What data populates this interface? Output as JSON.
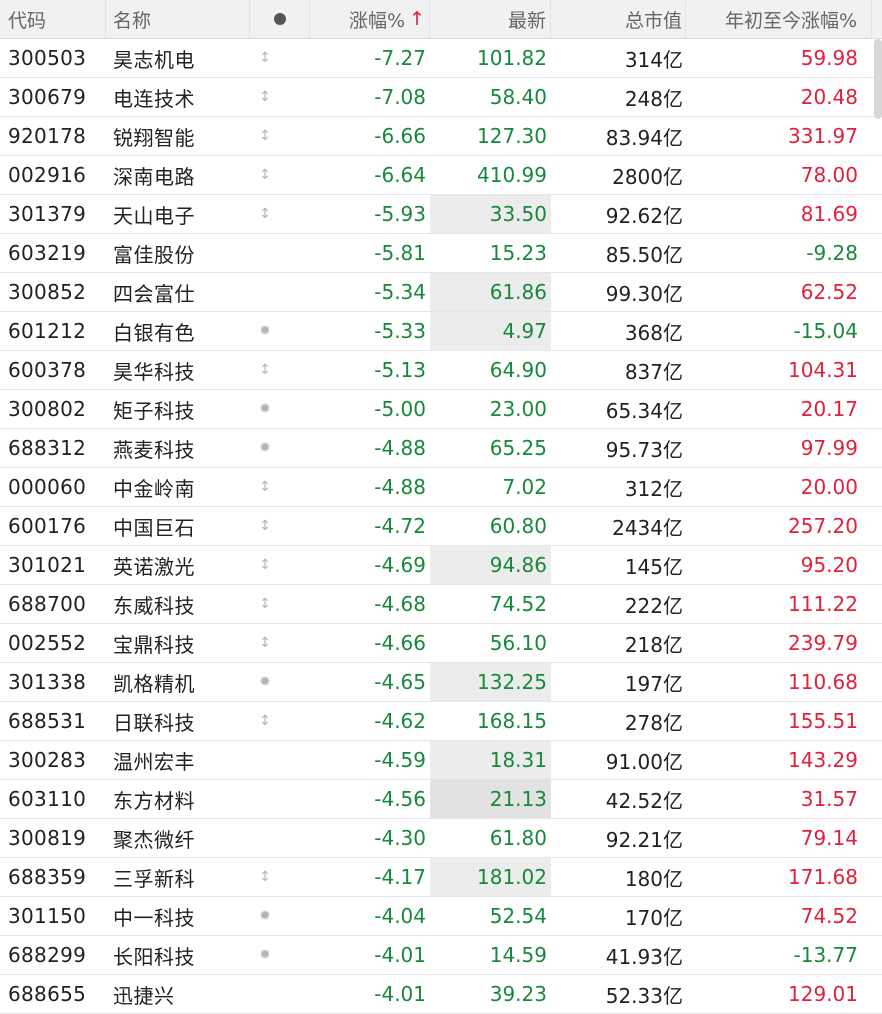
{
  "header": {
    "code": "代码",
    "name": "名称",
    "flag": "●",
    "change": "涨幅%",
    "sort_icon": "↑",
    "last": "最新",
    "mktcap": "总市值",
    "ytd": "年初至今涨幅%"
  },
  "colors": {
    "up": "#e0213b",
    "down": "#18883a",
    "header_bg": "#f1f1f1",
    "highlight_bg": "#ececec"
  },
  "rows": [
    {
      "code": "300503",
      "name": "昊志机电",
      "flag": "↕",
      "change": "-7.27",
      "last": "101.82",
      "mktcap": "314亿",
      "ytd": "59.98"
    },
    {
      "code": "300679",
      "name": "电连技术",
      "flag": "↕",
      "change": "-7.08",
      "last": "58.40",
      "mktcap": "248亿",
      "ytd": "20.48"
    },
    {
      "code": "920178",
      "name": "锐翔智能",
      "flag": "↕",
      "change": "-6.66",
      "last": "127.30",
      "mktcap": "83.94亿",
      "ytd": "331.97"
    },
    {
      "code": "002916",
      "name": "深南电路",
      "flag": "↕",
      "change": "-6.64",
      "last": "410.99",
      "mktcap": "2800亿",
      "ytd": "78.00"
    },
    {
      "code": "301379",
      "name": "天山电子",
      "flag": "↕",
      "change": "-5.93",
      "last": "33.50",
      "mktcap": "92.62亿",
      "ytd": "81.69"
    },
    {
      "code": "603219",
      "name": "富佳股份",
      "flag": "",
      "change": "-5.81",
      "last": "15.23",
      "mktcap": "85.50亿",
      "ytd": "-9.28"
    },
    {
      "code": "300852",
      "name": "四会富仕",
      "flag": "",
      "change": "-5.34",
      "last": "61.86",
      "mktcap": "99.30亿",
      "ytd": "62.52"
    },
    {
      "code": "601212",
      "name": "白银有色",
      "flag": "✹",
      "change": "-5.33",
      "last": "4.97",
      "mktcap": "368亿",
      "ytd": "-15.04"
    },
    {
      "code": "600378",
      "name": "昊华科技",
      "flag": "↕",
      "change": "-5.13",
      "last": "64.90",
      "mktcap": "837亿",
      "ytd": "104.31"
    },
    {
      "code": "300802",
      "name": "矩子科技",
      "flag": "✹",
      "change": "-5.00",
      "last": "23.00",
      "mktcap": "65.34亿",
      "ytd": "20.17"
    },
    {
      "code": "688312",
      "name": "燕麦科技",
      "flag": "✹",
      "change": "-4.88",
      "last": "65.25",
      "mktcap": "95.73亿",
      "ytd": "97.99"
    },
    {
      "code": "000060",
      "name": "中金岭南",
      "flag": "↕",
      "change": "-4.88",
      "last": "7.02",
      "mktcap": "312亿",
      "ytd": "20.00"
    },
    {
      "code": "600176",
      "name": "中国巨石",
      "flag": "↕",
      "change": "-4.72",
      "last": "60.80",
      "mktcap": "2434亿",
      "ytd": "257.20"
    },
    {
      "code": "301021",
      "name": "英诺激光",
      "flag": "↕",
      "change": "-4.69",
      "last": "94.86",
      "mktcap": "145亿",
      "ytd": "95.20"
    },
    {
      "code": "688700",
      "name": "东威科技",
      "flag": "↕",
      "change": "-4.68",
      "last": "74.52",
      "mktcap": "222亿",
      "ytd": "111.22"
    },
    {
      "code": "002552",
      "name": "宝鼎科技",
      "flag": "↕",
      "change": "-4.66",
      "last": "56.10",
      "mktcap": "218亿",
      "ytd": "239.79"
    },
    {
      "code": "301338",
      "name": "凯格精机",
      "flag": "✹",
      "change": "-4.65",
      "last": "132.25",
      "mktcap": "197亿",
      "ytd": "110.68"
    },
    {
      "code": "688531",
      "name": "日联科技",
      "flag": "↕",
      "change": "-4.62",
      "last": "168.15",
      "mktcap": "278亿",
      "ytd": "155.51"
    },
    {
      "code": "300283",
      "name": "温州宏丰",
      "flag": "",
      "change": "-4.59",
      "last": "18.31",
      "mktcap": "91.00亿",
      "ytd": "143.29"
    },
    {
      "code": "603110",
      "name": "东方材料",
      "flag": "",
      "change": "-4.56",
      "last": "21.13",
      "mktcap": "42.52亿",
      "ytd": "31.57"
    },
    {
      "code": "300819",
      "name": "聚杰微纤",
      "flag": "",
      "change": "-4.30",
      "last": "61.80",
      "mktcap": "92.21亿",
      "ytd": "79.14"
    },
    {
      "code": "688359",
      "name": "三孚新科",
      "flag": "↕",
      "change": "-4.17",
      "last": "181.02",
      "mktcap": "180亿",
      "ytd": "171.68"
    },
    {
      "code": "301150",
      "name": "中一科技",
      "flag": "✹",
      "change": "-4.04",
      "last": "52.54",
      "mktcap": "170亿",
      "ytd": "74.52"
    },
    {
      "code": "688299",
      "name": "长阳科技",
      "flag": "✹",
      "change": "-4.01",
      "last": "14.59",
      "mktcap": "41.93亿",
      "ytd": "-13.77"
    },
    {
      "code": "688655",
      "name": "迅捷兴",
      "flag": "",
      "change": "-4.01",
      "last": "39.23",
      "mktcap": "52.33亿",
      "ytd": "129.01"
    }
  ]
}
